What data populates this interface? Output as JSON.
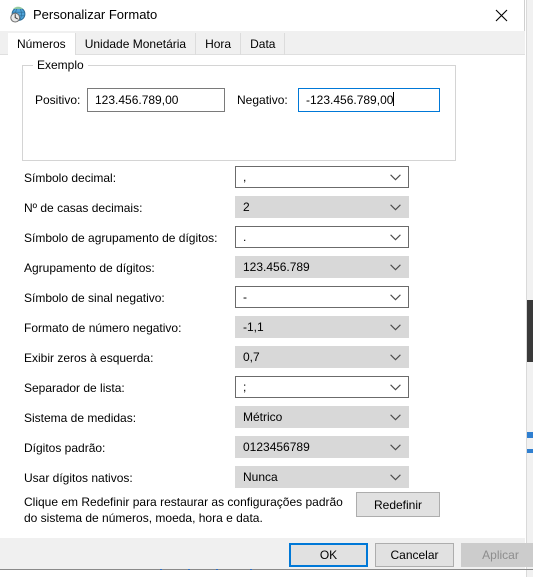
{
  "window": {
    "title": "Personalizar Formato",
    "icon": "region-globe-clock-icon",
    "close_label": "✕"
  },
  "tabs": [
    {
      "label": "Números",
      "selected": true
    },
    {
      "label": "Unidade Monetária",
      "selected": false
    },
    {
      "label": "Hora",
      "selected": false
    },
    {
      "label": "Data",
      "selected": false
    }
  ],
  "example": {
    "caption": "Exemplo",
    "positive_label": "Positivo:",
    "positive_value": "123.456.789,00",
    "negative_label": "Negativo:",
    "negative_value": "-123.456.789,00"
  },
  "settings": [
    {
      "label": "Símbolo decimal:",
      "value": ",",
      "style": "editable"
    },
    {
      "label": "Nº de casas decimais:",
      "value": "2",
      "style": "list"
    },
    {
      "label": "Símbolo de agrupamento de dígitos:",
      "value": ".",
      "style": "editable"
    },
    {
      "label": "Agrupamento de dígitos:",
      "value": "123.456.789",
      "style": "list"
    },
    {
      "label": "Símbolo de sinal negativo:",
      "value": "-",
      "style": "editable"
    },
    {
      "label": "Formato de número negativo:",
      "value": "-1,1",
      "style": "list"
    },
    {
      "label": "Exibir zeros à esquerda:",
      "value": "0,7",
      "style": "list"
    },
    {
      "label": "Separador de lista:",
      "value": ";",
      "style": "editable"
    },
    {
      "label": "Sistema de medidas:",
      "value": "Métrico",
      "style": "list"
    },
    {
      "label": "Dígitos padrão:",
      "value": "0123456789",
      "style": "list"
    },
    {
      "label": "Usar dígitos nativos:",
      "value": "Nunca",
      "style": "list"
    }
  ],
  "reset": {
    "text": "Clique em Redefinir para restaurar as configurações padrão do sistema de números, moeda, hora e data.",
    "button_label": "Redefinir"
  },
  "footer": {
    "ok_label": "OK",
    "cancel_label": "Cancelar",
    "apply_label": "Aplicar",
    "apply_disabled": true
  },
  "colors": {
    "accent": "#0078d7",
    "dialog_bg": "#f0f0f0",
    "content_bg": "#ffffff",
    "combo_list_bg": "#d8d8d8",
    "button_bg": "#e1e1e1",
    "disabled_text": "#8d8d8d"
  }
}
